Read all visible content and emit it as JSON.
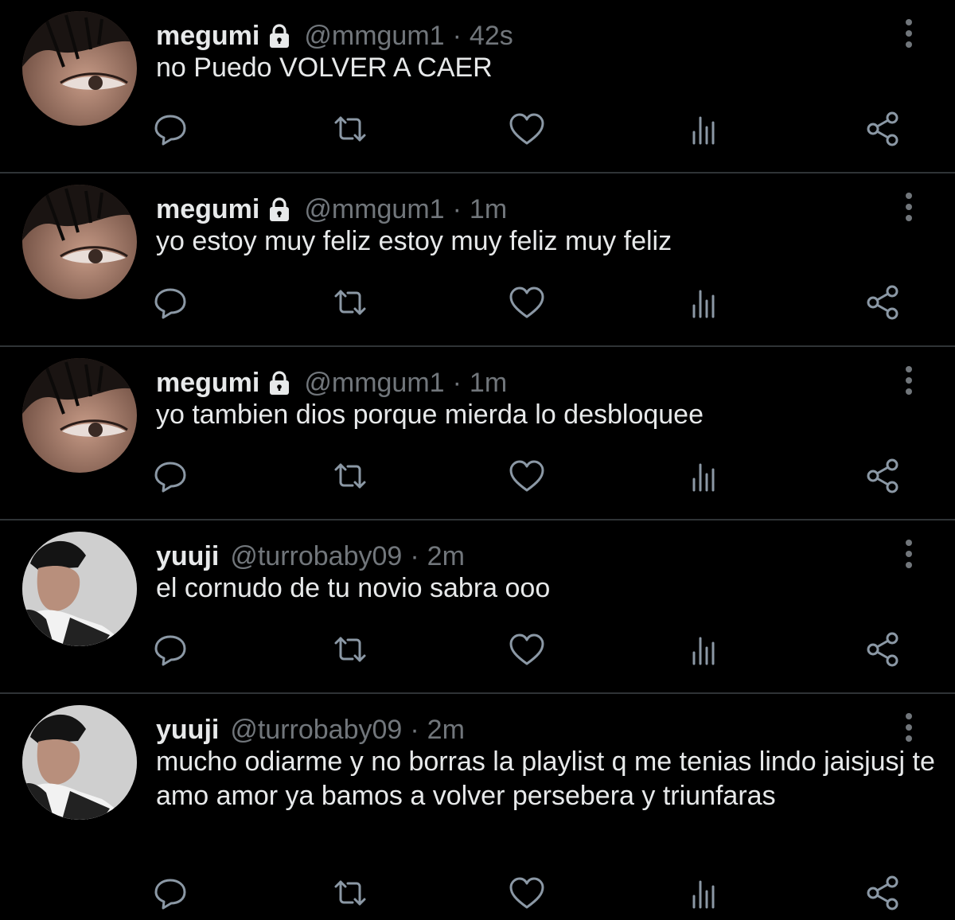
{
  "colors": {
    "background": "#000000",
    "text": "#e7e9ea",
    "secondary": "#71767b",
    "divider": "#2f3336"
  },
  "tweets": [
    {
      "name": "megumi",
      "locked": true,
      "handle": "@mmgum1",
      "separator": "·",
      "time": "42s",
      "text": "no Puedo VOLVER A CAER",
      "avatar": "megumi-avatar"
    },
    {
      "name": "megumi",
      "locked": true,
      "handle": "@mmgum1",
      "separator": "·",
      "time": "1m",
      "text": "yo estoy muy feliz estoy muy feliz muy feliz",
      "avatar": "megumi-avatar"
    },
    {
      "name": "megumi",
      "locked": true,
      "handle": "@mmgum1",
      "separator": "·",
      "time": "1m",
      "text": "yo tambien dios porque mierda lo desbloquee",
      "avatar": "megumi-avatar"
    },
    {
      "name": "yuuji",
      "locked": false,
      "handle": "@turrobaby09",
      "separator": "·",
      "time": "2m",
      "text": "el cornudo de tu novio sabra ooo",
      "avatar": "yuuji-avatar"
    },
    {
      "name": "yuuji",
      "locked": false,
      "handle": "@turrobaby09",
      "separator": "·",
      "time": "2m",
      "text": "mucho odiarme y no borras la playlist  q me tenias lindo jaisjusj te amo amor ya bamos a volver persebera y triunfaras",
      "avatar": "yuuji-avatar"
    }
  ],
  "action_icons": [
    "reply-icon",
    "retweet-icon",
    "like-icon",
    "analytics-icon",
    "share-icon"
  ]
}
